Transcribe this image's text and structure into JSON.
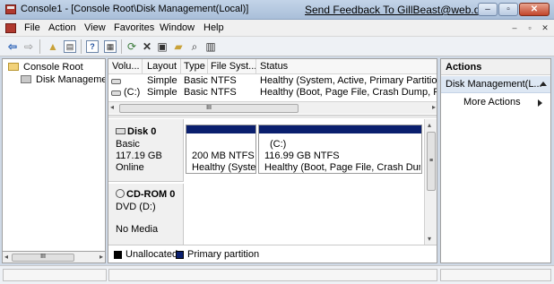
{
  "window": {
    "title": "Console1 - [Console Root\\Disk Management(Local)]",
    "feedback_link": "Send Feedback To GillBeast@web.de",
    "controls": {
      "minimize": "–",
      "maximize": "▫",
      "close": "✕"
    }
  },
  "menubar": {
    "items": [
      "File",
      "Action",
      "View",
      "Favorites",
      "Window",
      "Help"
    ],
    "mdi_controls": [
      "–",
      "▫",
      "✕"
    ]
  },
  "toolbar": {
    "icons": [
      "back-icon",
      "forward-icon",
      "up-folder-icon",
      "show-hide-tree-icon",
      "help-icon",
      "properties-icon",
      "refresh-icon",
      "delete-icon",
      "properties-sheet-icon",
      "open-folder-icon",
      "search-icon",
      "view-icon"
    ]
  },
  "tree": {
    "root": "Console Root",
    "child": "Disk Management"
  },
  "volumes": {
    "columns": [
      "Volu...",
      "Layout",
      "Type",
      "File Syst...",
      "Status"
    ],
    "rows": [
      {
        "volume": "",
        "layout": "Simple",
        "type": "Basic",
        "fs": "NTFS",
        "status": "Healthy (System, Active, Primary Partition)"
      },
      {
        "volume": "(C:)",
        "layout": "Simple",
        "type": "Basic",
        "fs": "NTFS",
        "status": "Healthy (Boot, Page File, Crash Dump, Primary"
      }
    ],
    "scroll_grip": "III"
  },
  "disks": [
    {
      "name": "Disk 0",
      "kind": "Basic",
      "size": "117.19 GB",
      "state": "Online",
      "partitions": [
        {
          "label": "",
          "size": "200 MB NTFS",
          "status": "Healthy (System"
        },
        {
          "label": "(C:)",
          "size": "116.99 GB NTFS",
          "status": "Healthy (Boot, Page File, Crash Dump, P"
        }
      ]
    },
    {
      "name": "CD-ROM 0",
      "kind": "DVD (D:)",
      "size": "",
      "state": "No Media",
      "partitions": []
    }
  ],
  "disk_scroll_grip": "≡",
  "legend": [
    {
      "label": "Unallocated",
      "color": "#000000"
    },
    {
      "label": "Primary partition",
      "color": "#0a1f6e"
    }
  ],
  "actions": {
    "header": "Actions",
    "section": "Disk Management(L...",
    "more": "More Actions"
  },
  "tree_scroll_grip": "III"
}
